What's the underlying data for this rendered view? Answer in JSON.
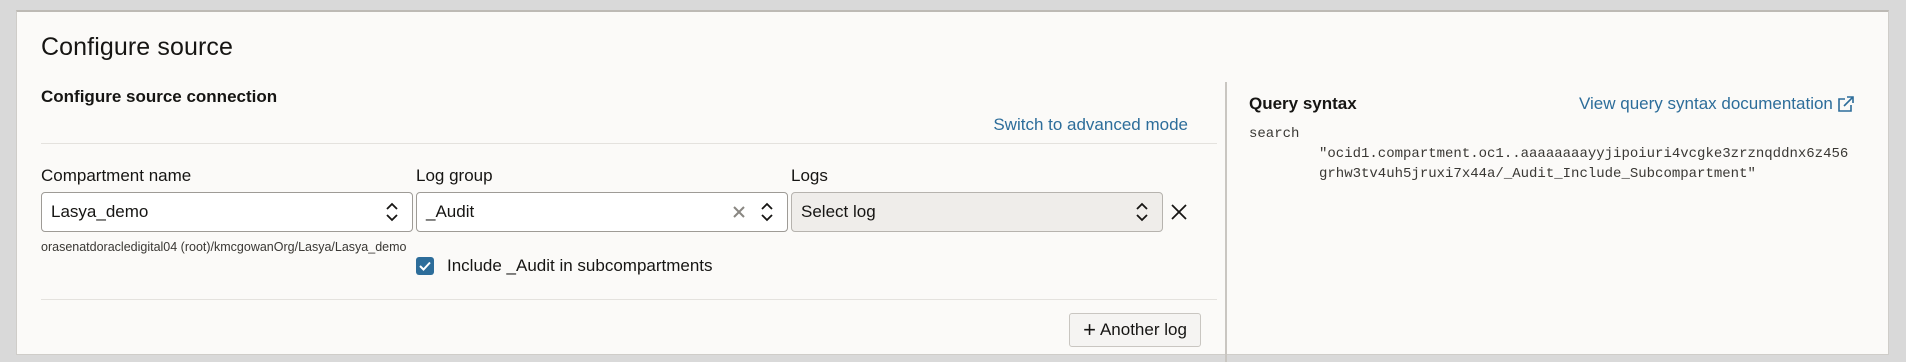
{
  "page": {
    "title": "Configure source"
  },
  "connection": {
    "section_title": "Configure source connection",
    "advanced_mode_link": "Switch to advanced mode",
    "compartment": {
      "label": "Compartment name",
      "value": "Lasya_demo",
      "path": "orasenatdoracledigital04 (root)/kmcgowanOrg/Lasya/Lasya_demo"
    },
    "log_group": {
      "label": "Log group",
      "value": "_Audit",
      "include_subcompartments_label": "Include _Audit in subcompartments",
      "include_subcompartments_checked": true
    },
    "logs": {
      "label": "Logs",
      "placeholder": "Select log"
    },
    "add_log_button": "Another log"
  },
  "query_syntax": {
    "title": "Query syntax",
    "doc_link": "View query syntax documentation",
    "keyword": "search",
    "query": "\"ocid1.compartment.oc1..aaaaaaaayyjipoiuri4vcgke3zrznqddnx6z456grhw3tv4uh5jruxi7x44a/_Audit_Include_Subcompartment\""
  },
  "colors": {
    "accent": "#2d6d9a",
    "background": "#fbfaf8"
  }
}
